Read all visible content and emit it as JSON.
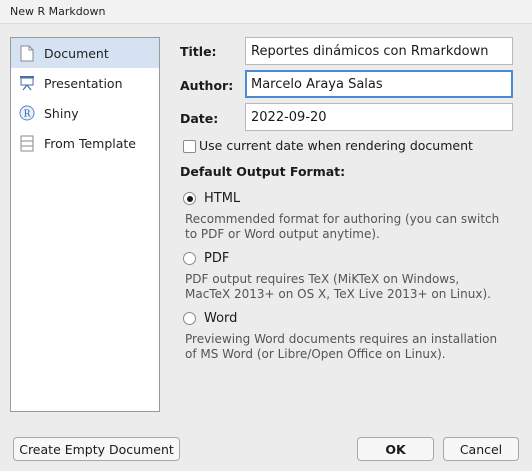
{
  "window": {
    "title": "New R Markdown"
  },
  "sidebar": {
    "items": [
      {
        "label": "Document",
        "icon": "document-icon",
        "selected": true
      },
      {
        "label": "Presentation",
        "icon": "presentation-icon",
        "selected": false
      },
      {
        "label": "Shiny",
        "icon": "shiny-icon",
        "selected": false
      },
      {
        "label": "From Template",
        "icon": "template-icon",
        "selected": false
      }
    ]
  },
  "form": {
    "title_label": "Title:",
    "title_value": "Reportes dinámicos con Rmarkdown",
    "author_label": "Author:",
    "author_value": "Marcelo Araya Salas",
    "date_label": "Date:",
    "date_value": "2022-09-20",
    "current_date_checkbox_label": "Use current date when rendering document",
    "current_date_checked": false
  },
  "output": {
    "section_label": "Default Output Format:",
    "options": [
      {
        "label": "HTML",
        "selected": true,
        "description_line1": "Recommended format for authoring (you can switch",
        "description_line2": "to PDF or Word output anytime)."
      },
      {
        "label": "PDF",
        "selected": false,
        "description_line1": "PDF output requires TeX (MiKTeX on Windows,",
        "description_line2": "MacTeX 2013+ on OS X, TeX Live 2013+ on Linux)."
      },
      {
        "label": "Word",
        "selected": false,
        "description_line1": "Previewing Word documents requires an installation",
        "description_line2": "of MS Word (or Libre/Open Office on Linux)."
      }
    ]
  },
  "buttons": {
    "create_empty": "Create Empty Document",
    "ok": "OK",
    "cancel": "Cancel"
  },
  "colors": {
    "selection": "#d5e2f2",
    "focus_border": "#4a8bd4",
    "dialog_bg": "#ececec"
  }
}
